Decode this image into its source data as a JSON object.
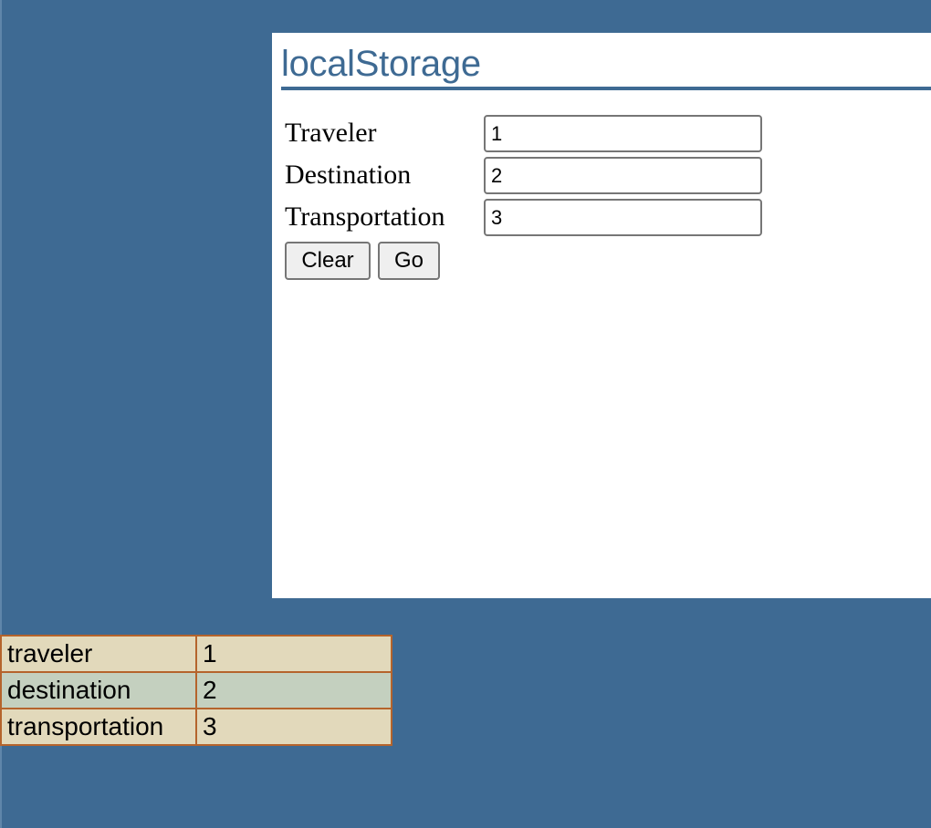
{
  "page": {
    "title": "localStorage"
  },
  "form": {
    "fields": [
      {
        "label": "Traveler",
        "value": "1"
      },
      {
        "label": "Destination",
        "value": "2"
      },
      {
        "label": "Transportation",
        "value": "3"
      }
    ],
    "clear_label": "Clear",
    "go_label": "Go"
  },
  "storage_table": {
    "rows": [
      {
        "key": "traveler",
        "value": "1"
      },
      {
        "key": "destination",
        "value": "2"
      },
      {
        "key": "transportation",
        "value": "3"
      }
    ]
  },
  "colors": {
    "background": "#3e6a93",
    "title": "#3e6a93",
    "table_border": "#b5642c",
    "table_row_odd": "#e2d9bb",
    "table_row_even": "#c4d0bf"
  }
}
